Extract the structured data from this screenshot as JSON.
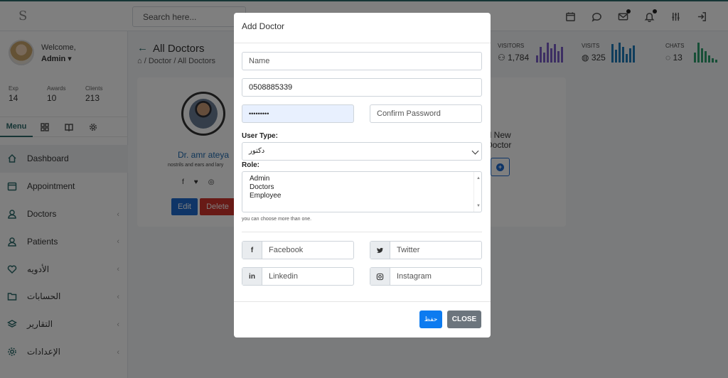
{
  "topbar": {
    "logo": "S",
    "search_placeholder": "Search here...",
    "icons": [
      "calendar-icon",
      "chat-icon",
      "mail-icon",
      "bell-icon",
      "sliders-icon",
      "logout-icon"
    ]
  },
  "sidebar": {
    "welcome": "Welcome,",
    "user_name": "Admin ▾",
    "stats": [
      {
        "label": "Exp",
        "value": "14"
      },
      {
        "label": "Awards",
        "value": "10"
      },
      {
        "label": "Clients",
        "value": "213"
      }
    ],
    "tabs": {
      "menu": "Menu"
    },
    "nav": [
      {
        "label": "Dashboard",
        "icon": "home-icon"
      },
      {
        "label": "Appointment",
        "icon": "calendar-icon"
      },
      {
        "label": "Doctors",
        "icon": "user-icon"
      },
      {
        "label": "Patients",
        "icon": "user-icon"
      },
      {
        "label": "الأدويه",
        "icon": "heart-icon"
      },
      {
        "label": "الحسابات",
        "icon": "folder-icon"
      },
      {
        "label": "التقارير",
        "icon": "layers-icon"
      },
      {
        "label": "الإعدادات",
        "icon": "gear-icon"
      }
    ]
  },
  "main": {
    "page_title": "All Doctors",
    "breadcrumb": {
      "doctor": "Doctor",
      "separator": "/",
      "all": "All Doctors"
    },
    "doctor_card": {
      "name": "Dr. amr ateya",
      "specialty": "nostrils and ears and lary",
      "edit": "Edit",
      "delete": "Delete"
    },
    "add_new": {
      "line1": "dd New",
      "line2": "Doctor"
    },
    "mini_stats": [
      {
        "label": "VISITORS",
        "value": "1,784",
        "color": "#7b5fc7"
      },
      {
        "label": "VISITS",
        "value": "325",
        "color": "#1f7ab8"
      },
      {
        "label": "CHATS",
        "value": "13",
        "color": "#2e9e6e"
      }
    ]
  },
  "modal": {
    "title": "Add Doctor",
    "name_placeholder": "Name",
    "phone_value": "0508885339",
    "password_value": "•••••••••",
    "confirm_placeholder": "Confirm Password",
    "user_type_label": "User Type:",
    "user_type_value": "دكتور",
    "role_label": "Role:",
    "roles": [
      "Admin",
      "Doctors",
      "Employee"
    ],
    "hint": "you can choose more than one.",
    "social": {
      "facebook": "Facebook",
      "twitter": "Twitter",
      "linkedin": "Linkedin",
      "instagram": "Instagram"
    },
    "save_label": "حفظ",
    "close_label": "CLOSE"
  }
}
